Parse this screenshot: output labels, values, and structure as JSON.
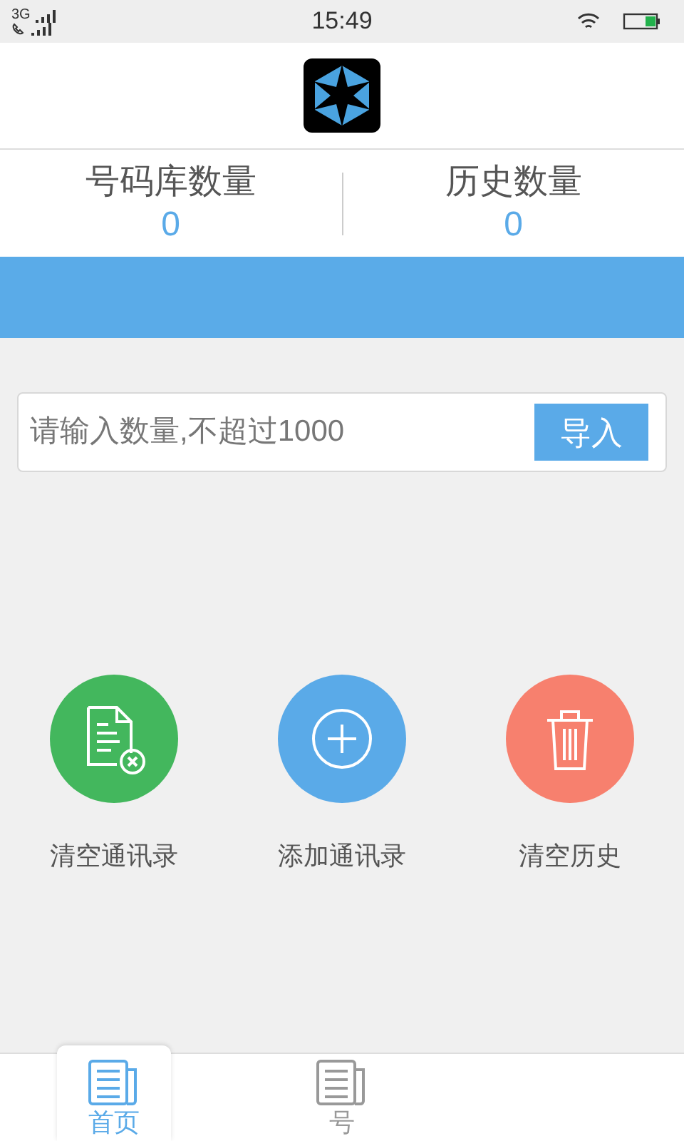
{
  "status_bar": {
    "network": "3G",
    "time": "15:49"
  },
  "stats": [
    {
      "label": "号码库数量",
      "value": "0"
    },
    {
      "label": "历史数量",
      "value": "0"
    }
  ],
  "import_form": {
    "placeholder": "请输入数量,不超过1000",
    "button": "导入"
  },
  "actions": [
    {
      "kind": "clear-contacts",
      "label": "清空通讯录",
      "color": "#43b75d"
    },
    {
      "kind": "add",
      "label": "添加通讯录",
      "color": "#5aaae8"
    },
    {
      "kind": "trash",
      "label": "清空历史",
      "color": "#f7806e"
    }
  ],
  "nav": [
    {
      "label": "首页",
      "selected": true
    },
    {
      "label": "号",
      "selected": false
    }
  ]
}
